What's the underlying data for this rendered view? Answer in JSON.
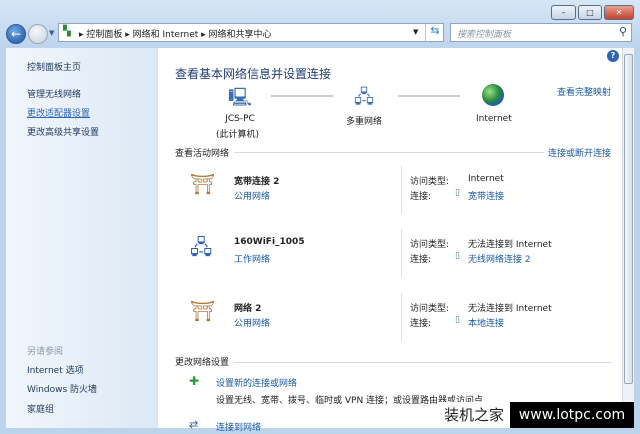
{
  "window": {
    "minimize": "–",
    "maximize": "□",
    "close": "✕"
  },
  "address": {
    "crumbs": [
      "控制面板",
      "网络和 Internet",
      "网络和共享中心"
    ],
    "search_placeholder": "搜索控制面板"
  },
  "sidebar": {
    "home": "控制面板主页",
    "items": [
      "管理无线网络",
      "更改适配器设置",
      "更改高级共享设置"
    ],
    "see_also_title": "另请参阅",
    "see_also": [
      "Internet 选项",
      "Windows 防火墙",
      "家庭组"
    ]
  },
  "main": {
    "title": "查看基本网络信息并设置连接",
    "view_full_map": "查看完整映射",
    "map": {
      "pc_name": "JCS-PC",
      "pc_sub": "(此计算机)",
      "middle": "多重网络",
      "internet": "Internet"
    },
    "active_title": "查看活动网络",
    "connect_disconnect": "连接或断开连接",
    "access_label": "访问类型:",
    "conn_label": "连接:",
    "networks": [
      {
        "name": "宽带连接  2",
        "category": "公用网络",
        "access": "Internet",
        "connection": "宽带连接"
      },
      {
        "name": "160WiFi_1005",
        "category": "工作网络",
        "access": "无法连接到 Internet",
        "connection": "无线网络连接 2"
      },
      {
        "name": "网络  2",
        "category": "公用网络",
        "access": "无法连接到 Internet",
        "connection": "本地连接"
      }
    ],
    "change_title": "更改网络设置",
    "tasks": [
      {
        "link": "设置新的连接或网络",
        "desc": "设置无线、宽带、拨号、临时或 VPN 连接；或设置路由器或访问点"
      },
      {
        "link": "连接到网络"
      }
    ]
  },
  "watermark": {
    "cn": "装机之家",
    "url": "www.lotpc.com"
  }
}
